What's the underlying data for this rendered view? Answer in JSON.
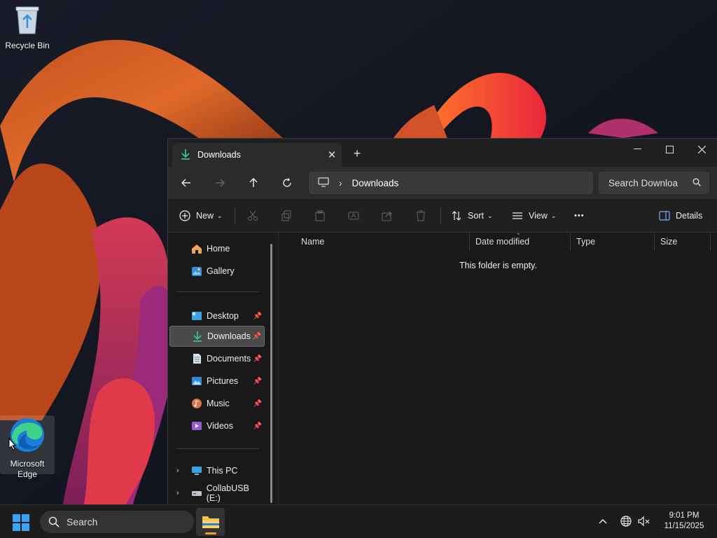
{
  "desktop": {
    "icons": [
      {
        "label": "Recycle Bin",
        "icon": "recycle-bin-icon"
      },
      {
        "label": "Microsoft Edge",
        "icon": "edge-icon"
      }
    ]
  },
  "explorer": {
    "tab_title": "Downloads",
    "tab_close": "✕",
    "new_tab": "+",
    "window_buttons": {
      "minimize": "—",
      "maximize": "☐",
      "close": "✕"
    },
    "address": {
      "segments": [
        "Downloads"
      ],
      "separator": "›"
    },
    "search_placeholder": "Search Downloa",
    "commands": {
      "new": "New",
      "sort": "Sort",
      "view": "View",
      "more": "•••",
      "details": "Details"
    },
    "nav": {
      "home": "Home",
      "gallery": "Gallery",
      "pinned": [
        {
          "label": "Desktop",
          "icon": "desktop-icon"
        },
        {
          "label": "Downloads",
          "icon": "download-icon",
          "selected": true
        },
        {
          "label": "Documents",
          "icon": "document-icon"
        },
        {
          "label": "Pictures",
          "icon": "pictures-icon"
        },
        {
          "label": "Music",
          "icon": "music-icon"
        },
        {
          "label": "Videos",
          "icon": "videos-icon"
        }
      ],
      "this_pc": "This PC",
      "usb": "CollabUSB (E:)"
    },
    "columns": [
      "Name",
      "Date modified",
      "Type",
      "Size"
    ],
    "empty_message": "This folder is empty."
  },
  "taskbar": {
    "search_placeholder": "Search",
    "clock": {
      "time": "9:01 PM",
      "date": "11/15/2025"
    }
  },
  "colors": {
    "accent": "#3aa3f6",
    "download_green": "#3cc08a",
    "folder_yellow": "#f5c542"
  }
}
